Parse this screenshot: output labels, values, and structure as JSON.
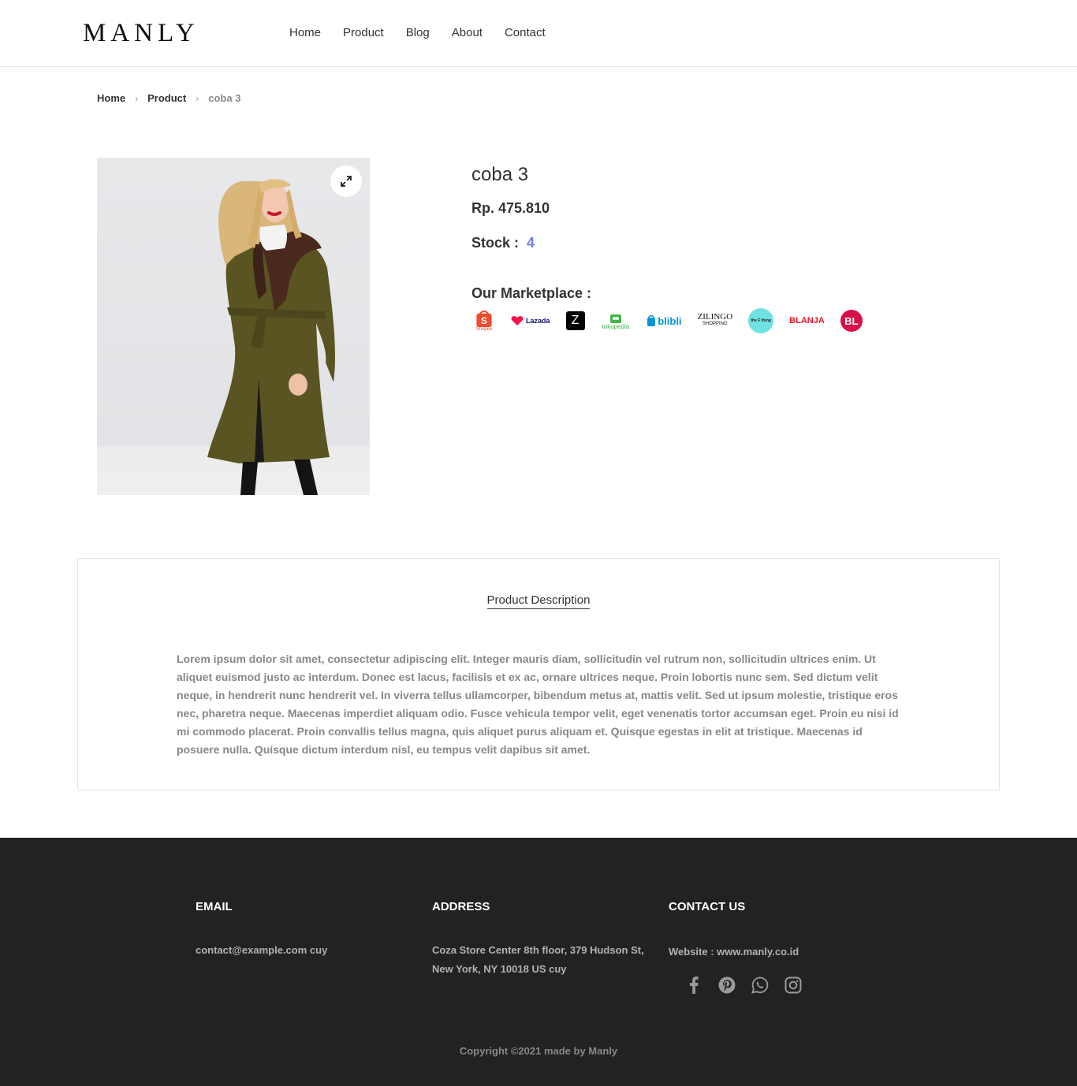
{
  "header": {
    "logo": "MANLY",
    "nav": [
      "Home",
      "Product",
      "Blog",
      "About",
      "Contact"
    ]
  },
  "breadcrumb": {
    "home": "Home",
    "product": "Product",
    "current": "coba 3"
  },
  "product": {
    "title": "coba 3",
    "price": "Rp. 475.810",
    "stock_label": "Stock :",
    "stock_value": "4",
    "marketplace_title": "Our Marketplace :",
    "marketplaces": [
      {
        "name": "Shopee",
        "label": "Shopee",
        "icon": "shopee-icon",
        "color": "#ee4d2d"
      },
      {
        "name": "Lazada",
        "label": "Lazada",
        "icon": "lazada-icon",
        "color": "#0f146d"
      },
      {
        "name": "Zalora",
        "label": "Z",
        "icon": "zalora-icon",
        "color": "#000000"
      },
      {
        "name": "Tokopedia",
        "label": "tokopedia",
        "icon": "tokopedia-icon",
        "color": "#42b549"
      },
      {
        "name": "Blibli",
        "label": "blibli",
        "icon": "blibli-icon",
        "color": "#0095da"
      },
      {
        "name": "Zilingo",
        "label": "ZILINGO",
        "sub": "SHOPPING",
        "icon": "zilingo-icon",
        "color": "#111111"
      },
      {
        "name": "The F Thing",
        "label": "the F thing",
        "icon": "thefthing-icon",
        "color": "#6fe3e3"
      },
      {
        "name": "Blanja",
        "label": "BLANJA",
        "icon": "blanja-icon",
        "color": "#e8142a"
      },
      {
        "name": "Bukalapak",
        "label": "BL",
        "icon": "bukalapak-icon",
        "color": "#d71149"
      }
    ]
  },
  "description": {
    "tab": "Product Description",
    "text": "Lorem ipsum dolor sit amet, consectetur adipiscing elit. Integer mauris diam, sollicitudin vel rutrum non, sollicitudin ultrices enim. Ut aliquet euismod justo ac interdum. Donec est lacus, facilisis et ex ac, ornare ultrices neque. Proin lobortis nunc sem. Sed dictum velit neque, in hendrerit nunc hendrerit vel. In viverra tellus ullamcorper, bibendum metus at, mattis velit. Sed ut ipsum molestie, tristique eros nec, pharetra neque. Maecenas imperdiet aliquam odio. Fusce vehicula tempor velit, eget venenatis tortor accumsan eget. Proin eu nisi id mi commodo placerat. Proin convallis tellus magna, quis aliquet purus aliquam et. Quisque egestas in elit at tristique. Maecenas id posuere nulla. Quisque dictum interdum nisl, eu tempus velit dapibus sit amet."
  },
  "footer": {
    "email_heading": "EMAIL",
    "email": "contact@example.com cuy",
    "address_heading": "ADDRESS",
    "address": "Coza Store Center 8th floor, 379 Hudson St, New York, NY 10018 US cuy",
    "contact_heading": "CONTACT US",
    "website": "Website : www.manly.co.id",
    "social_icons": [
      "facebook-icon",
      "pinterest-icon",
      "whatsapp-icon",
      "instagram-icon"
    ],
    "copyright": "Copyright ©2021 made by Manly"
  },
  "colors": {
    "accent": "#717fe0",
    "footer_bg": "#222222"
  }
}
